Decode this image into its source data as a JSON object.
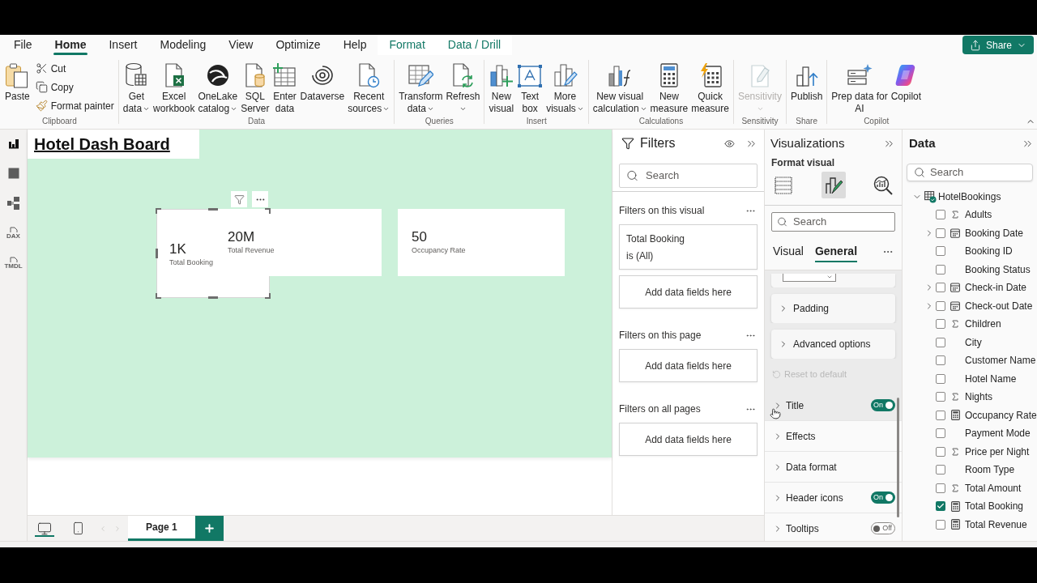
{
  "menu": {
    "tabs": [
      {
        "label": "File",
        "selected": false,
        "contextual": false
      },
      {
        "label": "Home",
        "selected": true,
        "contextual": false
      },
      {
        "label": "Insert",
        "selected": false,
        "contextual": false
      },
      {
        "label": "Modeling",
        "selected": false,
        "contextual": false
      },
      {
        "label": "View",
        "selected": false,
        "contextual": false
      },
      {
        "label": "Optimize",
        "selected": false,
        "contextual": false
      },
      {
        "label": "Help",
        "selected": false,
        "contextual": false
      },
      {
        "label": "Format",
        "selected": false,
        "contextual": true
      },
      {
        "label": "Data / Drill",
        "selected": false,
        "contextual": true
      }
    ],
    "share": "Share"
  },
  "ribbon": {
    "groups": [
      {
        "label": "Clipboard",
        "buttons": [
          {
            "kind": "large",
            "lines": [
              "Paste"
            ],
            "dropdown": false,
            "disabled": false
          },
          {
            "kind": "small",
            "lines": [
              "Cut"
            ],
            "dropdown": false,
            "disabled": false
          },
          {
            "kind": "small",
            "lines": [
              "Copy"
            ],
            "dropdown": false,
            "disabled": false
          },
          {
            "kind": "small",
            "lines": [
              "Format painter"
            ],
            "dropdown": false,
            "disabled": false
          }
        ]
      },
      {
        "label": "Data",
        "buttons": [
          {
            "kind": "large",
            "lines": [
              "Get",
              "data"
            ],
            "dropdown": true,
            "disabled": false
          },
          {
            "kind": "large",
            "lines": [
              "Excel",
              "workbook"
            ],
            "dropdown": false,
            "disabled": false
          },
          {
            "kind": "large",
            "lines": [
              "OneLake",
              "catalog"
            ],
            "dropdown": true,
            "disabled": false
          },
          {
            "kind": "large",
            "lines": [
              "SQL",
              "Server"
            ],
            "dropdown": false,
            "disabled": false
          },
          {
            "kind": "large",
            "lines": [
              "Enter",
              "data"
            ],
            "dropdown": false,
            "disabled": false
          },
          {
            "kind": "large",
            "lines": [
              "Dataverse"
            ],
            "dropdown": false,
            "disabled": false
          },
          {
            "kind": "large",
            "lines": [
              "Recent",
              "sources"
            ],
            "dropdown": true,
            "disabled": false
          }
        ]
      },
      {
        "label": "Queries",
        "buttons": [
          {
            "kind": "large",
            "lines": [
              "Transform",
              "data"
            ],
            "dropdown": true,
            "disabled": false
          },
          {
            "kind": "large",
            "lines": [
              "Refresh"
            ],
            "dropdown": true,
            "disabled": false
          }
        ]
      },
      {
        "label": "Insert",
        "buttons": [
          {
            "kind": "large",
            "lines": [
              "New",
              "visual"
            ],
            "dropdown": false,
            "disabled": false
          },
          {
            "kind": "large",
            "lines": [
              "Text",
              "box"
            ],
            "dropdown": false,
            "disabled": false
          },
          {
            "kind": "large",
            "lines": [
              "More",
              "visuals"
            ],
            "dropdown": true,
            "disabled": false
          }
        ]
      },
      {
        "label": "Calculations",
        "buttons": [
          {
            "kind": "large",
            "lines": [
              "New visual",
              "calculation"
            ],
            "dropdown": true,
            "disabled": false
          },
          {
            "kind": "large",
            "lines": [
              "New",
              "measure"
            ],
            "dropdown": false,
            "disabled": false
          },
          {
            "kind": "large",
            "lines": [
              "Quick",
              "measure"
            ],
            "dropdown": false,
            "disabled": false
          }
        ]
      },
      {
        "label": "Sensitivity",
        "buttons": [
          {
            "kind": "large",
            "lines": [
              "Sensitivity"
            ],
            "dropdown": true,
            "disabled": true
          }
        ]
      },
      {
        "label": "Share",
        "buttons": [
          {
            "kind": "large",
            "lines": [
              "Publish"
            ],
            "dropdown": false,
            "disabled": false
          }
        ]
      },
      {
        "label": "Copilot",
        "buttons": [
          {
            "kind": "large",
            "lines": [
              "Prep data for",
              "AI"
            ],
            "dropdown": false,
            "disabled": false
          },
          {
            "kind": "large",
            "lines": [
              "Copilot"
            ],
            "dropdown": false,
            "disabled": false
          }
        ]
      }
    ]
  },
  "rail": {
    "items": [
      {
        "selected": true
      },
      {
        "selected": false
      },
      {
        "selected": false
      },
      {
        "selected": false,
        "badge": "DAX"
      },
      {
        "selected": false,
        "badge": "TMDL"
      }
    ]
  },
  "canvas": {
    "title": "Hotel Dash Board",
    "cards": [
      {
        "value": "1K",
        "label": "Total Booking",
        "selected": true
      },
      {
        "value": "20M",
        "label": "Total Revenue",
        "selected": false
      },
      {
        "value": "50",
        "label": "Occupancy Rate",
        "selected": false
      }
    ]
  },
  "page_bar": {
    "views": [
      {
        "selected": true
      },
      {
        "selected": false
      }
    ],
    "pages": [
      {
        "label": "Page 1",
        "selected": true
      }
    ]
  },
  "filters": {
    "title": "Filters",
    "search": {
      "placeholder": "Search"
    },
    "sections": [
      {
        "title": "Filters on this visual",
        "filters": [
          {
            "field": "Total Booking",
            "condition": "is (All)"
          }
        ],
        "well": "Add data fields here"
      },
      {
        "title": "Filters on this page",
        "well": "Add data fields here"
      },
      {
        "title": "Filters on all pages",
        "well": "Add data fields here"
      }
    ]
  },
  "visualizations": {
    "title": "Visualizations",
    "subtitle": "Format visual",
    "modes": [
      {
        "selected": false
      },
      {
        "selected": true
      },
      {
        "selected": false
      }
    ],
    "search": {
      "placeholder": "Search"
    },
    "tabs": [
      {
        "label": "Visual",
        "selected": false
      },
      {
        "label": "General",
        "selected": true
      }
    ],
    "sections": [
      {
        "kind": "card",
        "label": "Padding"
      },
      {
        "kind": "card",
        "label": "Advanced options"
      },
      {
        "kind": "reset",
        "label": "Reset to default",
        "disabled": true
      },
      {
        "kind": "row",
        "label": "Title",
        "hovered": true,
        "toggle": {
          "label": "On",
          "on": true
        }
      },
      {
        "kind": "row",
        "label": "Effects",
        "hovered": false
      },
      {
        "kind": "row",
        "label": "Data format",
        "hovered": false
      },
      {
        "kind": "row",
        "label": "Header icons",
        "hovered": false,
        "toggle": {
          "label": "On",
          "on": true
        }
      },
      {
        "kind": "row",
        "label": "Tooltips",
        "hovered": false,
        "toggle": {
          "label": "Off",
          "on": false
        }
      }
    ]
  },
  "data": {
    "title": "Data",
    "search": {
      "placeholder": "Search"
    },
    "tree": [
      {
        "label": "HotelBookings",
        "expanded": true,
        "children": [
          {
            "label": "Adults",
            "kind": "sum",
            "checked": false
          },
          {
            "label": "Booking Date",
            "kind": "date",
            "checked": false,
            "expanded": false
          },
          {
            "label": "Booking ID",
            "kind": "text",
            "checked": false
          },
          {
            "label": "Booking Status",
            "kind": "text",
            "checked": false
          },
          {
            "label": "Check-in Date",
            "kind": "date",
            "checked": false,
            "expanded": false
          },
          {
            "label": "Check-out Date",
            "kind": "date",
            "checked": false,
            "expanded": false
          },
          {
            "label": "Children",
            "kind": "sum",
            "checked": false
          },
          {
            "label": "City",
            "kind": "text",
            "checked": false
          },
          {
            "label": "Customer Name",
            "kind": "text",
            "checked": false
          },
          {
            "label": "Hotel Name",
            "kind": "text",
            "checked": false
          },
          {
            "label": "Nights",
            "kind": "sum",
            "checked": false
          },
          {
            "label": "Occupancy Rate",
            "kind": "measure",
            "checked": false
          },
          {
            "label": "Payment Mode",
            "kind": "text",
            "checked": false
          },
          {
            "label": "Price per Night",
            "kind": "sum",
            "checked": false
          },
          {
            "label": "Room Type",
            "kind": "text",
            "checked": false
          },
          {
            "label": "Total Amount",
            "kind": "sum",
            "checked": false
          },
          {
            "label": "Total Booking",
            "kind": "measure",
            "checked": true
          },
          {
            "label": "Total Revenue",
            "kind": "measure",
            "checked": false
          }
        ]
      }
    ]
  }
}
